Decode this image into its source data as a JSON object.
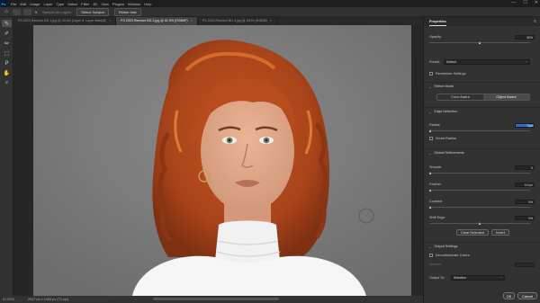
{
  "menubar": {
    "logo": "Ps",
    "items": [
      "File",
      "Edit",
      "Image",
      "Layer",
      "Type",
      "Select",
      "Filter",
      "3D",
      "View",
      "Plugins",
      "Window",
      "Help"
    ],
    "controls": [
      "—",
      "☐",
      "✕"
    ]
  },
  "options": {
    "brush_size": "5",
    "sample_label": "Sample All Layers",
    "select_subject": "Select Subject",
    "refine_hair": "Refine Hair"
  },
  "tabs": [
    {
      "label": "PS 2023 Remove BG 1.jpg @ 33.4% (Layer 0, Layer Mask/8)",
      "active": false
    },
    {
      "label": "PS 2023 Remove BG 3.jpg @ 51.5% (RGB/8*)",
      "active": true
    },
    {
      "label": "PS 2023 Remove BG 4.jpg @ 100% (RGB/8)",
      "active": false
    }
  ],
  "status": {
    "zoom": "51.52%",
    "docinfo": "2047 px x 1463 px (72 ppi)"
  },
  "panel": {
    "title": "Properties",
    "opacity_label": "Opacity",
    "opacity_value": "50%",
    "opacity_level": 0.5,
    "preset_label": "Preset:",
    "preset_value": "Default",
    "remember_label": "Remember Settings",
    "refine_mode": "Refine Mode",
    "color_aware": "Color Aware",
    "object_aware": "Object Aware",
    "edge_detection": "Edge Detection",
    "radius_label": "Radius",
    "radius_value": "0 px",
    "smart_radius": "Smart Radius",
    "global_refinements": "Global Refinements",
    "smooth_label": "Smooth",
    "smooth_value": "0",
    "feather_label": "Feather",
    "feather_value": "0.0 px",
    "contrast_label": "Contrast",
    "contrast_value": "0%",
    "shift_edge_label": "Shift Edge",
    "shift_edge_value": "0%",
    "clear_selection": "Clear Selection",
    "invert": "Invert",
    "output_settings": "Output Settings",
    "decontaminate": "Decontaminate Colors",
    "amount_label": "Amount",
    "output_to_label": "Output To:",
    "output_to_value": "Selection",
    "ok": "OK",
    "cancel": "Cancel"
  },
  "colors": {
    "accent": "#2a6ad9",
    "background_gray": "#7a7a7a",
    "hair": "#b24a1c",
    "skin": "#e3ab8c"
  },
  "tools": [
    "quick-selection-icon",
    "brush-icon",
    "refine-edge-brush-icon",
    "object-selection-icon",
    "lasso-icon",
    "hand-icon",
    "zoom-icon"
  ]
}
